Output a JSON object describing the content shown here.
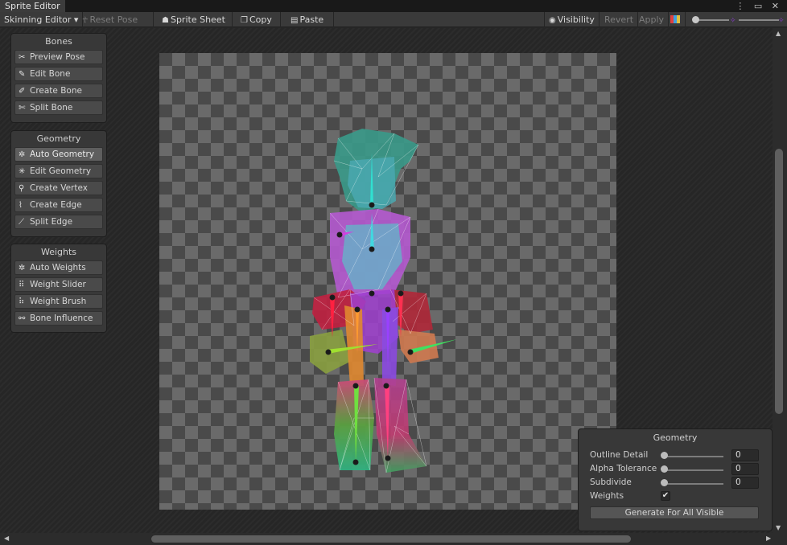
{
  "window": {
    "tab_title": "Sprite Editor",
    "controls": "⋮ ▭ ✕"
  },
  "toolbar": {
    "mode_dropdown": "Skinning Editor ▾",
    "reset_pose": "Reset Pose",
    "sprite_sheet": "Sprite Sheet",
    "copy": "Copy",
    "paste": "Paste",
    "visibility": "Visibility",
    "revert": "Revert",
    "apply": "Apply"
  },
  "panels": {
    "bones": {
      "title": "Bones",
      "items": [
        {
          "label": "Preview Pose",
          "icon": "preview-pose-icon",
          "glyph": "✂"
        },
        {
          "label": "Edit Bone",
          "icon": "edit-bone-icon",
          "glyph": "✎"
        },
        {
          "label": "Create Bone",
          "icon": "create-bone-icon",
          "glyph": "✐"
        },
        {
          "label": "Split Bone",
          "icon": "split-bone-icon",
          "glyph": "✄"
        }
      ]
    },
    "geometry": {
      "title": "Geometry",
      "items": [
        {
          "label": "Auto Geometry",
          "icon": "auto-geometry-icon",
          "glyph": "✲",
          "active": true
        },
        {
          "label": "Edit Geometry",
          "icon": "edit-geometry-icon",
          "glyph": "✳"
        },
        {
          "label": "Create Vertex",
          "icon": "create-vertex-icon",
          "glyph": "⚲"
        },
        {
          "label": "Create Edge",
          "icon": "create-edge-icon",
          "glyph": "⌇"
        },
        {
          "label": "Split Edge",
          "icon": "split-edge-icon",
          "glyph": "⟋"
        }
      ]
    },
    "weights": {
      "title": "Weights",
      "items": [
        {
          "label": "Auto Weights",
          "icon": "auto-weights-icon",
          "glyph": "✲"
        },
        {
          "label": "Weight Slider",
          "icon": "weight-slider-icon",
          "glyph": "⠿"
        },
        {
          "label": "Weight Brush",
          "icon": "weight-brush-icon",
          "glyph": "⠷"
        },
        {
          "label": "Bone Influence",
          "icon": "bone-influence-icon",
          "glyph": "⚯"
        }
      ]
    }
  },
  "geometry_settings": {
    "title": "Geometry",
    "outline_detail": {
      "label": "Outline Detail",
      "value": "0"
    },
    "alpha_tolerance": {
      "label": "Alpha Tolerance",
      "value": "0"
    },
    "subdivide": {
      "label": "Subdivide",
      "value": "0"
    },
    "weights": {
      "label": "Weights",
      "checked": true,
      "mark": "✔"
    },
    "generate_button": "Generate For All Visible"
  },
  "colors": {
    "accent_purple": "#8a3bd0",
    "panel_bg": "#383838",
    "editor_bg": "#282828"
  }
}
